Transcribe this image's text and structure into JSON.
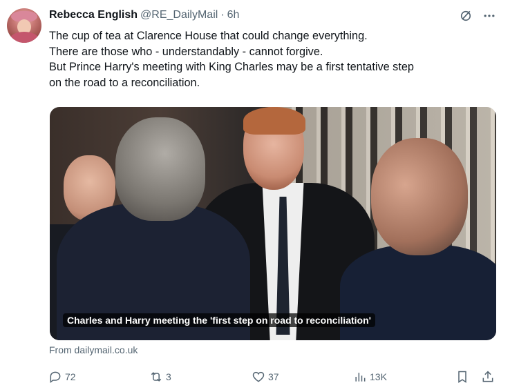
{
  "tweet": {
    "author_name": "Rebecca English",
    "author_handle": "@RE_DailyMail",
    "separator": "·",
    "time": "6h",
    "text_lines": [
      "The cup of tea at Clarence House that could change everything.",
      "There are those who - understandably - cannot forgive.",
      "But Prince Harry's meeting with King Charles may be a first tentative step",
      "on the road to a reconciliation."
    ],
    "media_caption": "Charles and Harry meeting the 'first step on road to reconciliation'",
    "link_source": "From dailymail.co.uk"
  },
  "icons": {
    "top": [
      "grok-icon",
      "more-icon"
    ],
    "actions": [
      "reply-icon",
      "retweet-icon",
      "like-icon",
      "views-icon",
      "bookmark-icon",
      "share-icon"
    ]
  },
  "actions": {
    "replies": "72",
    "retweets": "3",
    "likes": "37",
    "views": "13K"
  }
}
